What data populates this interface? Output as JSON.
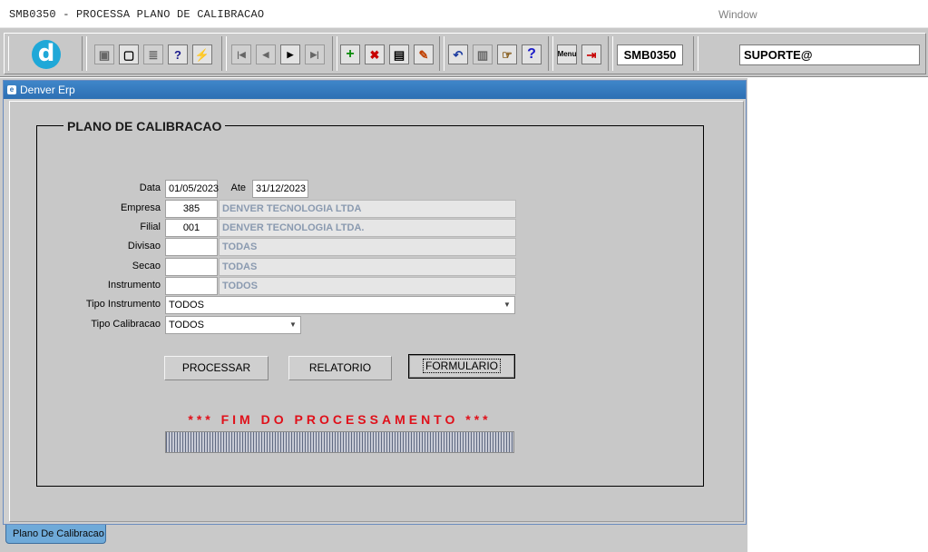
{
  "window": {
    "title": "SMB0350 - PROCESSA PLANO DE CALIBRACAO",
    "menu_label": "Window"
  },
  "toolbar": {
    "logo_letter": "d",
    "form_code": "SMB0350",
    "user": "SUPORTE@",
    "buttons": [
      {
        "name": "save-icon",
        "glyph": "▣"
      },
      {
        "name": "print-preview-icon",
        "glyph": "▢"
      },
      {
        "name": "print-icon",
        "glyph": "≣"
      },
      {
        "name": "query-help-icon",
        "glyph": "?"
      },
      {
        "name": "execute-query-icon",
        "glyph": "⚡"
      },
      {
        "name": "first-record-icon",
        "glyph": "⏮"
      },
      {
        "name": "previous-record-icon",
        "glyph": "◀"
      },
      {
        "name": "next-record-icon",
        "glyph": "▶"
      },
      {
        "name": "last-record-icon",
        "glyph": "⏭"
      },
      {
        "name": "insert-record-icon",
        "glyph": "+"
      },
      {
        "name": "delete-record-icon",
        "glyph": "✖"
      },
      {
        "name": "clear-record-icon",
        "glyph": "▤"
      },
      {
        "name": "edit-icon",
        "glyph": "✎"
      },
      {
        "name": "undo-icon",
        "glyph": "↶"
      },
      {
        "name": "clipboard-icon",
        "glyph": "▥"
      },
      {
        "name": "list-of-values-icon",
        "glyph": "☞"
      },
      {
        "name": "help-icon",
        "glyph": "?"
      },
      {
        "name": "menu-icon",
        "glyph": "M"
      },
      {
        "name": "exit-icon",
        "glyph": "⇥"
      }
    ]
  },
  "inner_window": {
    "title": "Denver Erp"
  },
  "form": {
    "frame_title": "PLANO DE CALIBRACAO",
    "data_label": "Data",
    "data_from": "01/05/2023",
    "ate_label": "Ate",
    "data_to": "31/12/2023",
    "empresa_label": "Empresa",
    "empresa_code": "385",
    "empresa_name": "DENVER TECNOLOGIA LTDA",
    "filial_label": "Filial",
    "filial_code": "001",
    "filial_name": "DENVER TECNOLOGIA LTDA.",
    "divisao_label": "Divisao",
    "divisao_code": "",
    "divisao_name": "TODAS",
    "secao_label": "Secao",
    "secao_code": "",
    "secao_name": "TODAS",
    "instrumento_label": "Instrumento",
    "instrumento_code": "",
    "instrumento_name": "TODOS",
    "tipo_instrumento_label": "Tipo Instrumento",
    "tipo_instrumento_value": "TODOS",
    "tipo_calibracao_label": "Tipo Calibracao",
    "tipo_calibracao_value": "TODOS",
    "btn_processar": "PROCESSAR",
    "btn_relatorio": "RELATORIO",
    "btn_formulario": "FORMULARIO",
    "status_message": "*** FIM DO PROCESSAMENTO ***",
    "progress_percent": 100
  },
  "tabs": {
    "bottom_tab": "Plano De Calibracao"
  },
  "colors": {
    "title_bar_blue": "#2d6fb3",
    "status_red": "#e0101a",
    "tab_blue": "#6faad9"
  }
}
